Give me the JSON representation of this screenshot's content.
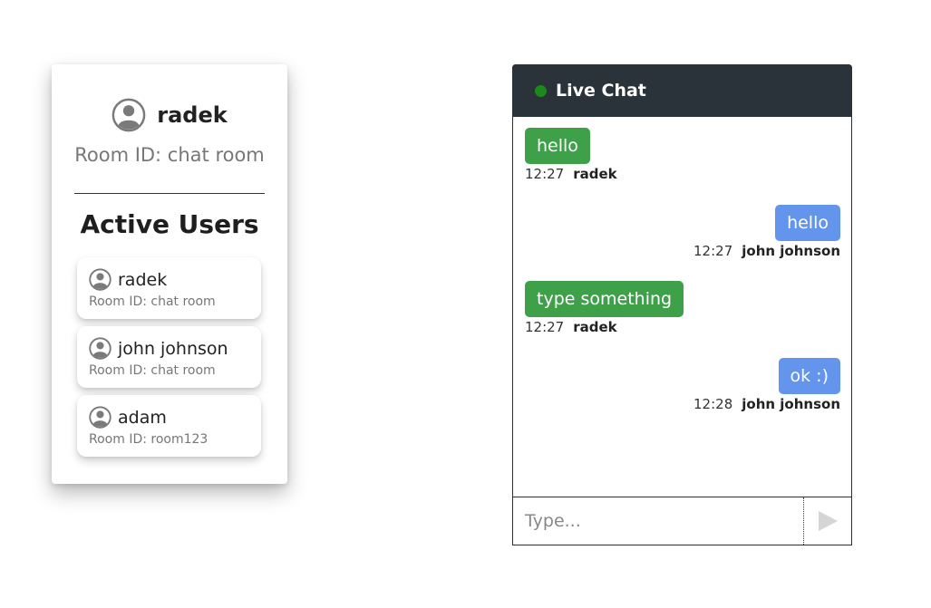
{
  "current_user": {
    "name": "radek",
    "room_label": "Room ID: chat room",
    "icon": "user-circle-icon"
  },
  "active_users": {
    "title": "Active Users",
    "users": [
      {
        "name": "radek",
        "room": "Room ID: chat room"
      },
      {
        "name": "john johnson",
        "room": "Room ID: chat room"
      },
      {
        "name": "adam",
        "room": "Room ID: room123"
      }
    ]
  },
  "chat": {
    "title": "Live Chat",
    "status_color": "#1b8a1b",
    "header_color": "#2a323a",
    "messages": [
      {
        "text": "hello",
        "time": "12:27",
        "author": "radek",
        "side": "left",
        "color": "#3fa04a"
      },
      {
        "text": "hello",
        "time": "12:27",
        "author": "john johnson",
        "side": "right",
        "color": "#6495ed"
      },
      {
        "text": "type something",
        "time": "12:27",
        "author": "radek",
        "side": "left",
        "color": "#3fa04a"
      },
      {
        "text": "ok :)",
        "time": "12:28",
        "author": "john johnson",
        "side": "right",
        "color": "#6495ed"
      }
    ],
    "input": {
      "placeholder": "Type...",
      "value": ""
    },
    "send_icon": "send-triangle-icon"
  }
}
